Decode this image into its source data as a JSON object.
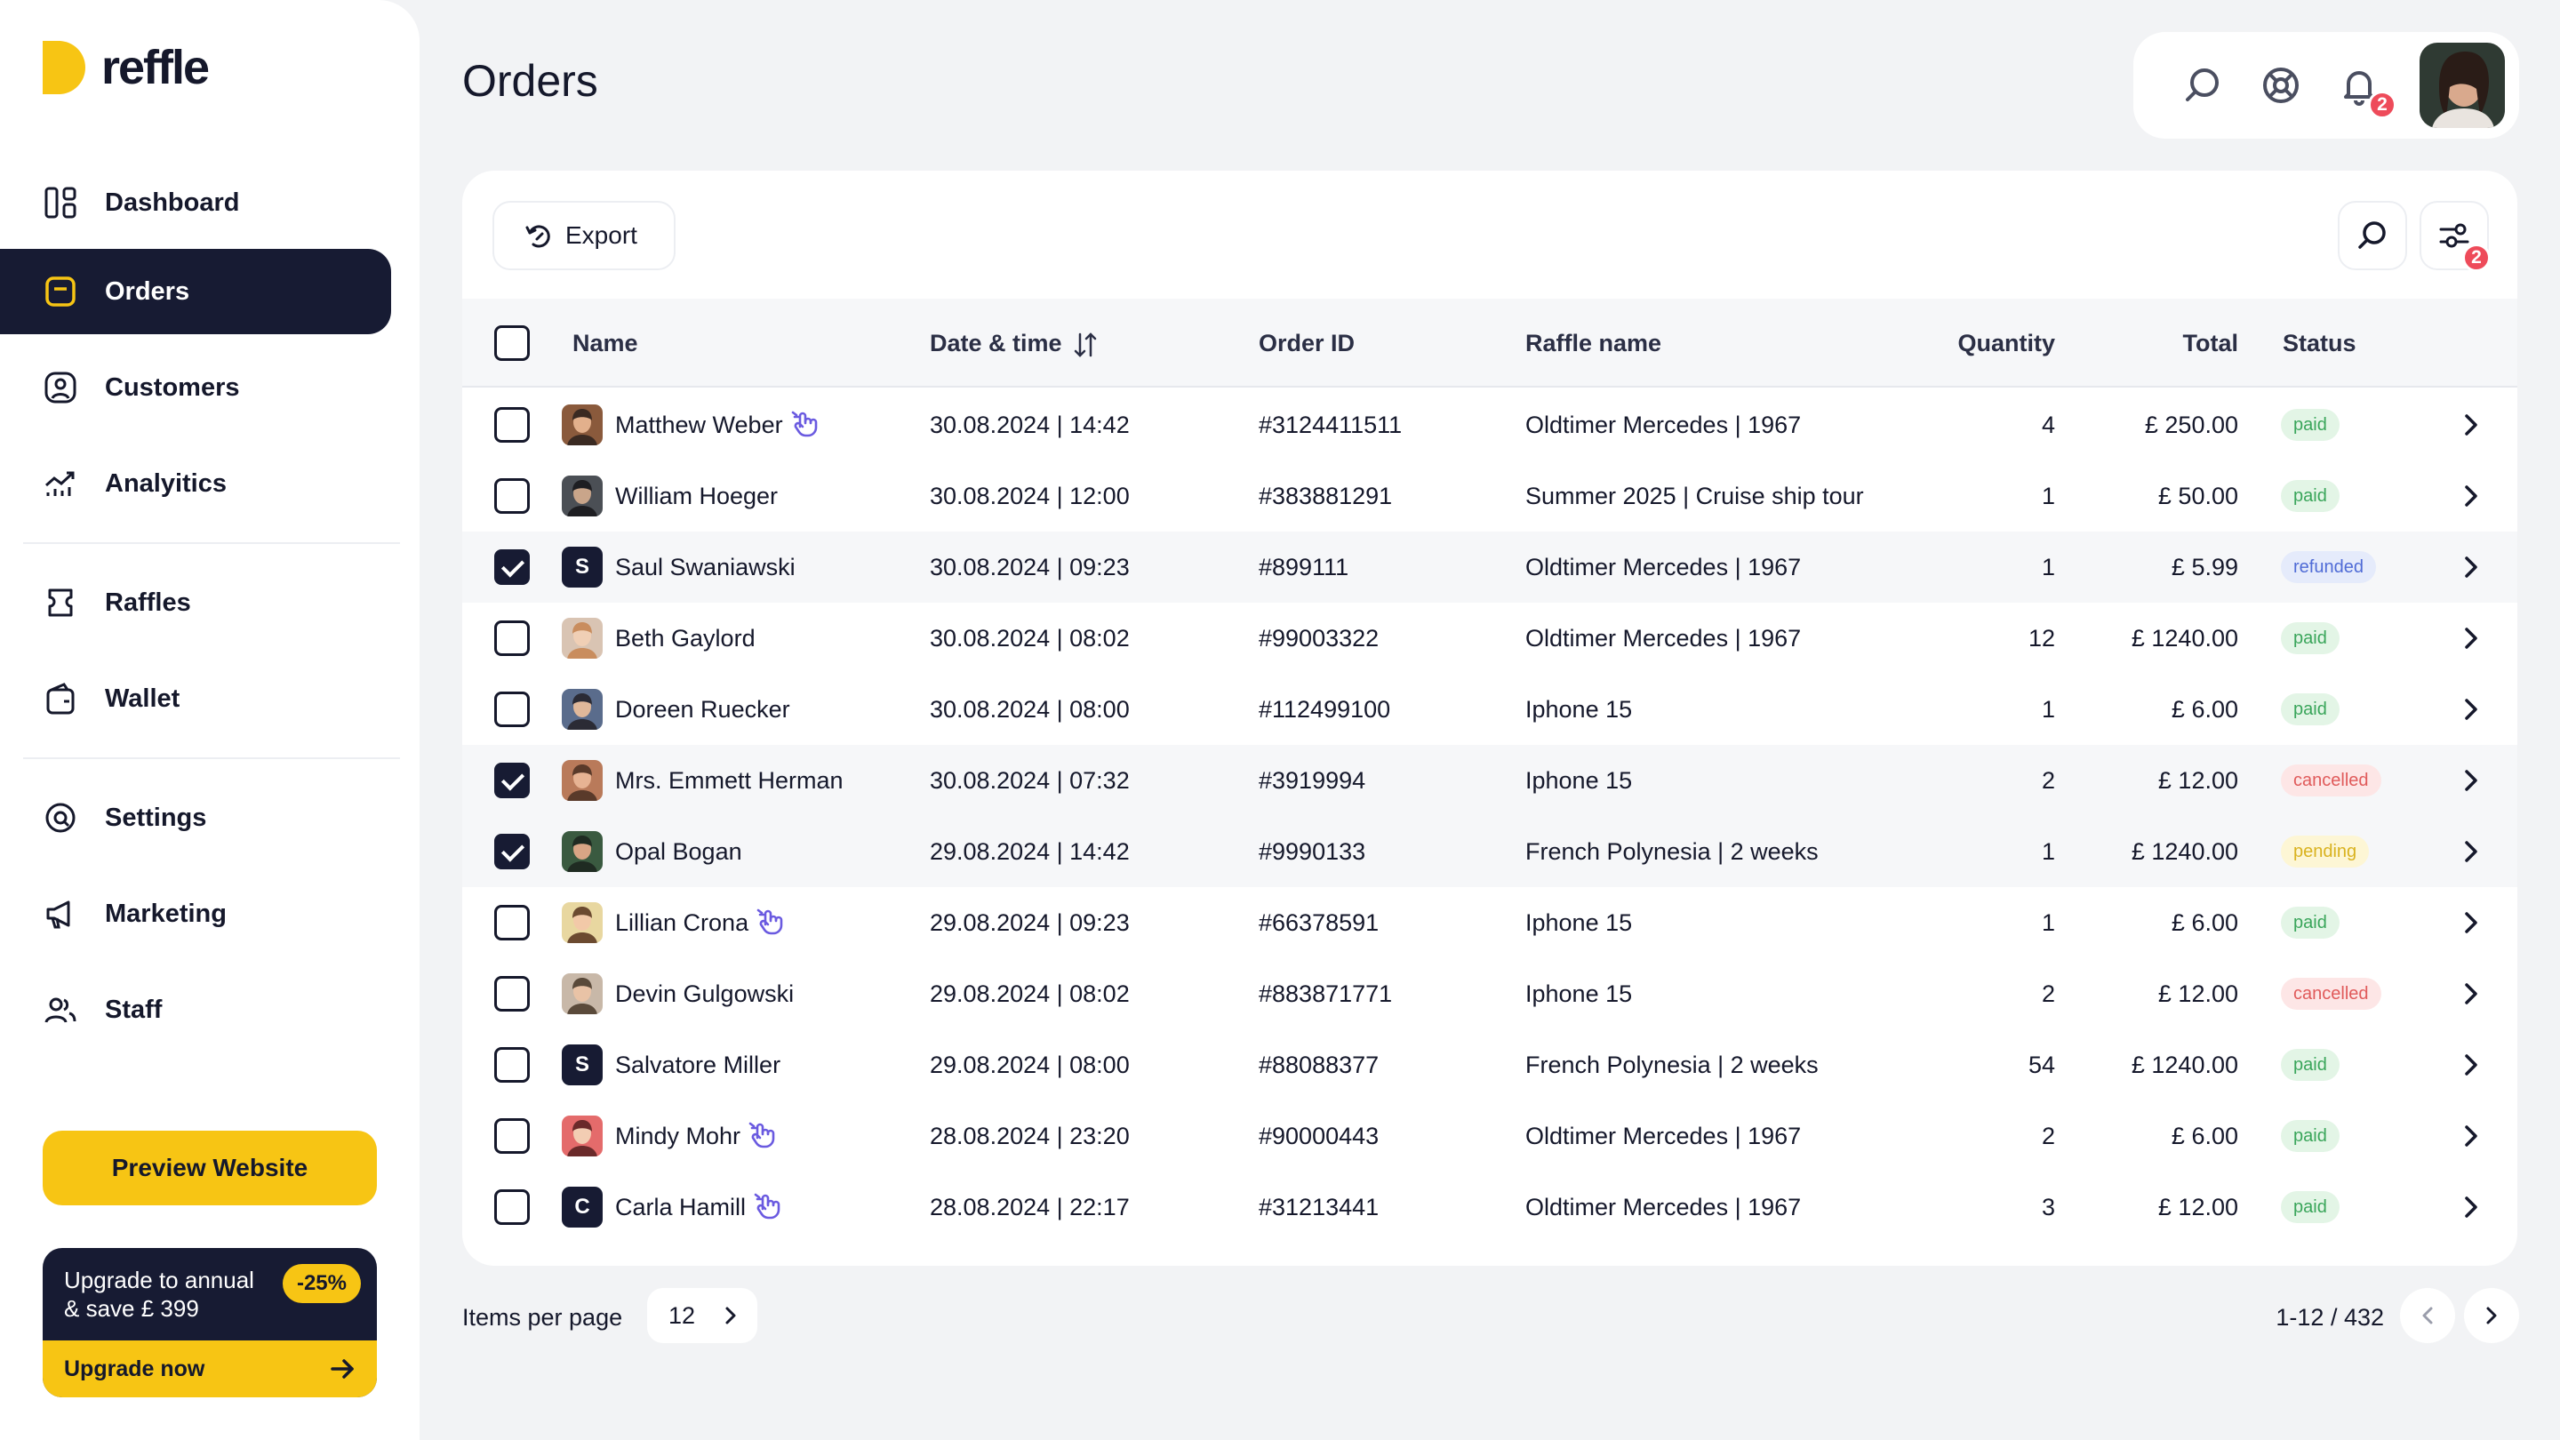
{
  "brand": {
    "name": "reffle",
    "accent": "#f7c514",
    "navy": "#171b33"
  },
  "sidebar": {
    "items": [
      {
        "label": "Dashboard",
        "icon": "dashboard-icon",
        "active": false
      },
      {
        "label": "Orders",
        "icon": "orders-icon",
        "active": true
      },
      {
        "label": "Customers",
        "icon": "customers-icon",
        "active": false
      },
      {
        "label": "Analyitics",
        "icon": "analytics-icon",
        "active": false
      },
      {
        "label": "Raffles",
        "icon": "raffles-icon",
        "active": false
      },
      {
        "label": "Wallet",
        "icon": "wallet-icon",
        "active": false
      },
      {
        "label": "Settings",
        "icon": "settings-icon",
        "active": false
      },
      {
        "label": "Marketing",
        "icon": "marketing-icon",
        "active": false
      },
      {
        "label": "Staff",
        "icon": "staff-icon",
        "active": false
      }
    ],
    "preview_label": "Preview Website",
    "upgrade": {
      "line1": "Upgrade to annual",
      "line2": "& save £ 399",
      "discount": "-25%",
      "cta": "Upgrade now"
    }
  },
  "header": {
    "title": "Orders",
    "notification_count": "2",
    "tools": [
      "search-icon",
      "help-icon",
      "bell-icon"
    ]
  },
  "toolbar": {
    "export_label": "Export",
    "filter_count": "2"
  },
  "table": {
    "columns": {
      "name": "Name",
      "datetime": "Date & time",
      "order_id": "Order ID",
      "raffle": "Raffle name",
      "quantity": "Quantity",
      "total": "Total",
      "status": "Status"
    },
    "rows": [
      {
        "name": "Matthew Weber",
        "avatar": "photo",
        "ring": true,
        "datetime": "30.08.2024 | 14:42",
        "order_id": "#3124411511",
        "raffle": "Oldtimer Mercedes | 1967",
        "quantity": "4",
        "total": "£ 250.00",
        "status": "paid",
        "selected": false
      },
      {
        "name": "William Hoeger",
        "avatar": "photo",
        "ring": false,
        "datetime": "30.08.2024 | 12:00",
        "order_id": "#383881291",
        "raffle": "Summer 2025 | Cruise ship tour",
        "quantity": "1",
        "total": "£ 50.00",
        "status": "paid",
        "selected": false
      },
      {
        "name": "Saul Swaniawski",
        "avatar": "S",
        "ring": false,
        "datetime": "30.08.2024 | 09:23",
        "order_id": "#899111",
        "raffle": "Oldtimer Mercedes | 1967",
        "quantity": "1",
        "total": "£ 5.99",
        "status": "refunded",
        "selected": true
      },
      {
        "name": "Beth Gaylord",
        "avatar": "photo",
        "ring": false,
        "datetime": "30.08.2024 | 08:02",
        "order_id": "#99003322",
        "raffle": "Oldtimer Mercedes | 1967",
        "quantity": "12",
        "total": "£ 1240.00",
        "status": "paid",
        "selected": false
      },
      {
        "name": "Doreen Ruecker",
        "avatar": "photo",
        "ring": false,
        "datetime": "30.08.2024 | 08:00",
        "order_id": "#112499100",
        "raffle": "Iphone 15",
        "quantity": "1",
        "total": "£ 6.00",
        "status": "paid",
        "selected": false
      },
      {
        "name": "Mrs. Emmett Herman",
        "avatar": "photo",
        "ring": false,
        "datetime": "30.08.2024 | 07:32",
        "order_id": "#3919994",
        "raffle": "Iphone 15",
        "quantity": "2",
        "total": "£ 12.00",
        "status": "cancelled",
        "selected": true
      },
      {
        "name": "Opal Bogan",
        "avatar": "photo",
        "ring": false,
        "datetime": "29.08.2024 | 14:42",
        "order_id": "#9990133",
        "raffle": "French Polynesia | 2 weeks",
        "quantity": "1",
        "total": "£ 1240.00",
        "status": "pending",
        "selected": true
      },
      {
        "name": "Lillian Crona",
        "avatar": "photo",
        "ring": true,
        "datetime": "29.08.2024 | 09:23",
        "order_id": "#66378591",
        "raffle": "Iphone 15",
        "quantity": "1",
        "total": "£ 6.00",
        "status": "paid",
        "selected": false
      },
      {
        "name": "Devin Gulgowski",
        "avatar": "photo",
        "ring": false,
        "datetime": "29.08.2024 | 08:02",
        "order_id": "#883871771",
        "raffle": "Iphone 15",
        "quantity": "2",
        "total": "£ 12.00",
        "status": "cancelled",
        "selected": false
      },
      {
        "name": "Salvatore Miller",
        "avatar": "S",
        "ring": false,
        "datetime": "29.08.2024 | 08:00",
        "order_id": "#88088377",
        "raffle": "French Polynesia | 2 weeks",
        "quantity": "54",
        "total": "£ 1240.00",
        "status": "paid",
        "selected": false
      },
      {
        "name": "Mindy Mohr",
        "avatar": "photo",
        "ring": true,
        "datetime": "28.08.2024 | 23:20",
        "order_id": "#90000443",
        "raffle": "Oldtimer Mercedes | 1967",
        "quantity": "2",
        "total": "£ 6.00",
        "status": "paid",
        "selected": false
      },
      {
        "name": "Carla Hamill",
        "avatar": "C",
        "ring": true,
        "datetime": "28.08.2024 | 22:17",
        "order_id": "#31213441",
        "raffle": "Oldtimer Mercedes | 1967",
        "quantity": "3",
        "total": "£ 12.00",
        "status": "paid",
        "selected": false
      }
    ]
  },
  "footer": {
    "items_per_page_label": "Items per page",
    "items_per_page_value": "12",
    "page_info": "1-12 / 432"
  }
}
